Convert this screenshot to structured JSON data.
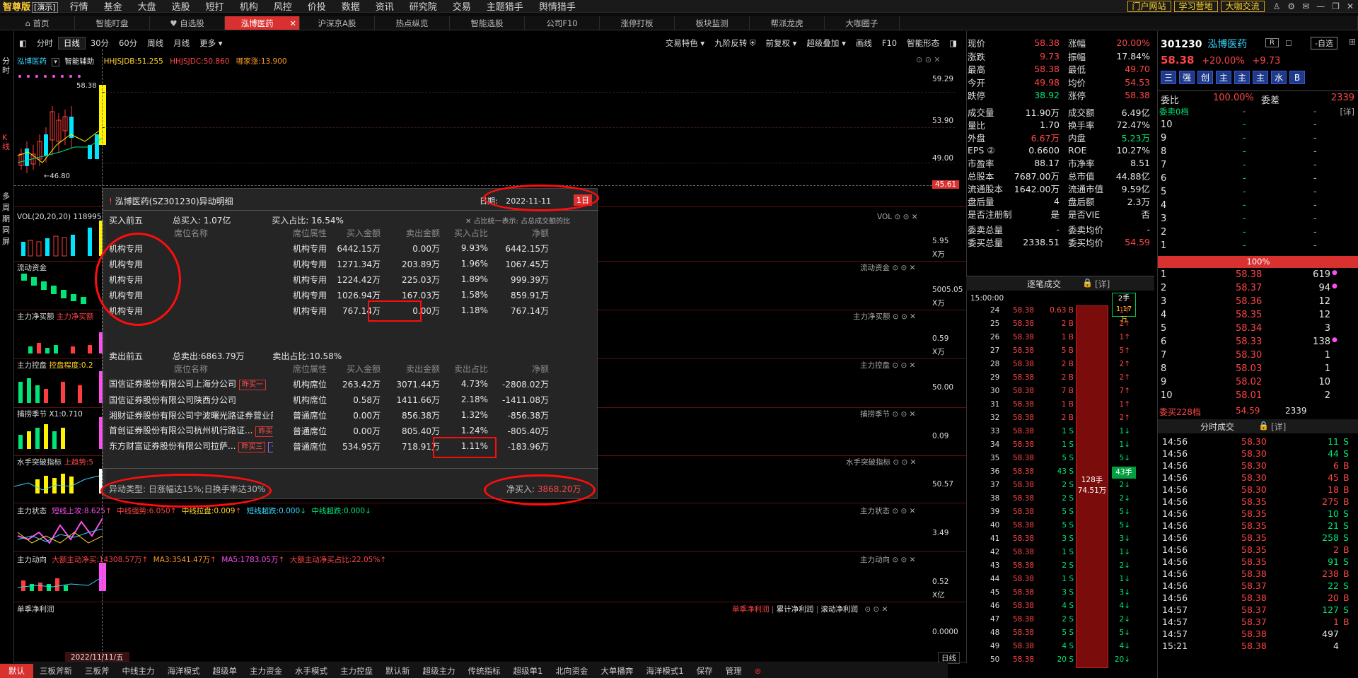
{
  "topbar": {
    "logo": "智尊版",
    "mode": "[演示]",
    "menu": [
      "行情",
      "基金",
      "大盘",
      "选股",
      "短打",
      "机构",
      "风控",
      "价投",
      "数据",
      "资讯",
      "研究院",
      "交易",
      "主题猎手",
      "舆情猎手"
    ],
    "ext": [
      "门户网站",
      "学习营地",
      "大咖交流"
    ],
    "zoom": "95%"
  },
  "tabs": [
    "首页",
    "智能盯盘",
    "自选股",
    "泓博医药",
    "沪深京A股",
    "热点纵览",
    "智能选股",
    "公司F10",
    "涨停打板",
    "板块监测",
    "帮派龙虎",
    "大咖圈子"
  ],
  "chart_toolbar": {
    "periods": [
      "分时",
      "日线",
      "30分",
      "60分",
      "周线",
      "月线",
      "更多"
    ],
    "right": [
      "交易特色",
      "九阶反转",
      "前复权",
      "超级叠加",
      "画线",
      "F10",
      "智能形态"
    ]
  },
  "kline": {
    "name": "泓博医药",
    "assist": "智能辅助",
    "ind1": "HHJSJDB:51.255",
    "ind2": "HHJSJDC:50.860",
    "ind3": "哪家涨:13.900",
    "high": "58.38",
    "low": "46.80",
    "axis": [
      "59.29",
      "53.90",
      "49.00",
      "45.61"
    ]
  },
  "sidebar": [
    "分时",
    "K线",
    "多周期同屏"
  ],
  "panels": [
    {
      "name": "VOL(20,20,20)",
      "vals": "118995",
      "tag": "VOL",
      "axis": [
        "5.95",
        "X万"
      ]
    },
    {
      "name": "流动资金",
      "tag": "流动资金",
      "axis": [
        "5005.05",
        "X万"
      ]
    },
    {
      "name": "主力净买额",
      "vals": "主力净买额",
      "tag": "主力净买额",
      "axis": [
        "0.59",
        "X万"
      ]
    },
    {
      "name": "主力控盘",
      "vals": "控盘程度:0.2",
      "tag": "主力控盘",
      "axis": [
        "50.00"
      ]
    },
    {
      "name": "捕捞季节",
      "vals": "X1:0.710",
      "tag": "捕捞季节",
      "axis": [
        "0.09"
      ]
    },
    {
      "name": "水手突破指标",
      "vals": "上趋势:5",
      "tag": "水手突破指标",
      "axis": [
        "50.57"
      ]
    },
    {
      "name": "主力状态",
      "vals": [
        "短线上攻:8.625",
        "中线强势:6.050",
        "中线拉盘:0.009",
        "短线超跌:0.000",
        "中线超跌:0.000"
      ],
      "tag": "主力状态",
      "axis": [
        "3.49"
      ]
    },
    {
      "name": "主力动向",
      "vals": [
        "大额主动净买:14308.57万",
        "MA3:3541.47万",
        "MA5:1783.05万",
        "大额主动净买占比:22.05%"
      ],
      "tag": "主力动向",
      "axis": [
        "0.52",
        "X亿"
      ]
    },
    {
      "name": "单季净利润",
      "tabs": [
        "单季净利润",
        "累计净利润",
        "滚动净利润"
      ],
      "axis": [
        "0.0000"
      ]
    }
  ],
  "date_label": "2022/11/11/五",
  "dayline": "日线",
  "popup": {
    "title": "泓博医药(SZ301230)异动明细",
    "date_label": "日期:",
    "date": "2022-11-11",
    "day_btn": "1日",
    "buy_label": "买入前五",
    "buy_total": "总买入: 1.07亿",
    "buy_ratio": "买入占比: 16.54%",
    "note": "占比统一表示: 占总成交额的比",
    "headers": [
      "席位名称",
      "席位属性",
      "买入金额",
      "卖出金额",
      "买入占比",
      "净额"
    ],
    "buy_rows": [
      [
        "机构专用",
        "机构专用",
        "6442.15万",
        "0.00万",
        "9.93%",
        "6442.15万"
      ],
      [
        "机构专用",
        "机构专用",
        "1271.34万",
        "203.89万",
        "1.96%",
        "1067.45万"
      ],
      [
        "机构专用",
        "机构专用",
        "1224.42万",
        "225.03万",
        "1.89%",
        "999.39万"
      ],
      [
        "机构专用",
        "机构专用",
        "1026.94万",
        "167.03万",
        "1.58%",
        "859.91万"
      ],
      [
        "机构专用",
        "机构专用",
        "767.14万",
        "0.00万",
        "1.18%",
        "767.14万"
      ]
    ],
    "sell_label": "卖出前五",
    "sell_total": "总卖出:6863.79万",
    "sell_ratio": "卖出占比:10.58%",
    "sell_headers": [
      "席位名称",
      "席位属性",
      "买入金额",
      "卖出金额",
      "卖出占比",
      "净额"
    ],
    "sell_rows": [
      {
        "name": "国信证券股份有限公司上海分公司",
        "tags": [
          "昨买一"
        ],
        "attr": "机构席位",
        "buy": "263.42万",
        "sell": "3071.44万",
        "ratio": "4.73%",
        "net": "-2808.02万"
      },
      {
        "name": "国信证券股份有限公司陕西分公司",
        "tags": [],
        "attr": "机构席位",
        "buy": "0.58万",
        "sell": "1411.66万",
        "ratio": "2.18%",
        "net": "-1411.08万"
      },
      {
        "name": "湘财证券股份有限公司宁波曙光路证券营业部",
        "tags": [],
        "attr": "普通席位",
        "buy": "0.00万",
        "sell": "856.38万",
        "ratio": "1.32%",
        "net": "-856.38万"
      },
      {
        "name": "首创证券股份有限公司杭州机行路证...",
        "tags": [
          "昨买二"
        ],
        "attr": "普通席位",
        "buy": "0.00万",
        "sell": "805.40万",
        "ratio": "1.24%",
        "net": "-805.40万"
      },
      {
        "name": "东方财富证券股份有限公司拉萨...",
        "tags": [
          "昨买三",
          "一线"
        ],
        "attr": "普通席位",
        "buy": "534.95万",
        "sell": "718.91万",
        "ratio": "1.11%",
        "net": "-183.96万"
      }
    ],
    "type_label": "异动类型:",
    "type_text": "日涨幅达15%;日换手率达30%",
    "net_label": "净买入:",
    "net_value": "3868.20万"
  },
  "quote": {
    "rows": [
      [
        "现价",
        "58.38",
        "涨幅",
        "20.00%"
      ],
      [
        "涨跌",
        "9.73",
        "振幅",
        "17.84%"
      ],
      [
        "最高",
        "58.38",
        "最低",
        "49.70"
      ],
      [
        "今开",
        "49.98",
        "均价",
        "54.53"
      ],
      [
        "跌停",
        "38.92",
        "涨停",
        "58.38"
      ],
      [
        "成交量",
        "11.90万",
        "成交额",
        "6.49亿"
      ],
      [
        "量比",
        "1.70",
        "换手率",
        "72.47%"
      ],
      [
        "外盘",
        "6.67万",
        "内盘",
        "5.23万"
      ],
      [
        "EPS ②",
        "0.6600",
        "ROE",
        "10.27%"
      ],
      [
        "市盈率",
        "88.17",
        "市净率",
        "8.51"
      ],
      [
        "总股本",
        "7687.00万",
        "总市值",
        "44.88亿"
      ],
      [
        "流通股本",
        "1642.00万",
        "流通市值",
        "9.59亿"
      ],
      [
        "盘后量",
        "4",
        "盘后额",
        "2.3万"
      ],
      [
        "是否注册制",
        "是",
        "是否VIE",
        "否"
      ],
      [
        "委卖总量",
        "-",
        "委卖均价",
        "-"
      ],
      [
        "委买总量",
        "2338.51",
        "委买均价",
        "54.59"
      ]
    ],
    "tick_title": "逐笔成交",
    "tick_detail": "[详]",
    "time_label": "15:00:00"
  },
  "ticks": [
    [
      "24",
      "58.38",
      "0.63 B",
      "1↑"
    ],
    [
      "25",
      "58.38",
      "2 B",
      "2↑"
    ],
    [
      "26",
      "58.38",
      "1 B",
      "1↑"
    ],
    [
      "27",
      "58.38",
      "5 B",
      "5↑"
    ],
    [
      "28",
      "58.38",
      "2 B",
      "2↑"
    ],
    [
      "29",
      "58.38",
      "2 B",
      "2↑"
    ],
    [
      "30",
      "58.38",
      "7 B",
      "7↑"
    ],
    [
      "31",
      "58.38",
      "1 B",
      "1↑"
    ],
    [
      "32",
      "58.38",
      "2 B",
      "2↑"
    ],
    [
      "33",
      "58.38",
      "1 S",
      "1↓"
    ],
    [
      "34",
      "58.38",
      "1 S",
      "1↓"
    ],
    [
      "35",
      "58.38",
      "5 S",
      "5↓"
    ],
    [
      "36",
      "58.38",
      "43 S",
      ""
    ],
    [
      "37",
      "58.38",
      "2 S",
      "2↓"
    ],
    [
      "38",
      "58.38",
      "2 S",
      "2↓"
    ],
    [
      "39",
      "58.38",
      "5 S",
      "5↓"
    ],
    [
      "40",
      "58.38",
      "5 S",
      "5↓"
    ],
    [
      "41",
      "58.38",
      "3 S",
      "3↓"
    ],
    [
      "42",
      "58.38",
      "1 S",
      "1↓"
    ],
    [
      "43",
      "58.38",
      "2 S",
      "2↓"
    ],
    [
      "44",
      "58.38",
      "1 S",
      "1↓"
    ],
    [
      "45",
      "58.38",
      "3 S",
      "3↓"
    ],
    [
      "46",
      "58.38",
      "4 S",
      "4↓"
    ],
    [
      "47",
      "58.38",
      "2 S",
      "2↓"
    ],
    [
      "48",
      "58.38",
      "5 S",
      "5↓"
    ],
    [
      "49",
      "58.38",
      "4 S",
      "4↓"
    ],
    [
      "50",
      "58.38",
      "20 S",
      "20↓"
    ]
  ],
  "tick_bar": {
    "top_label": "2手",
    "top_sub": "1.17万",
    "mid": "128手",
    "mid2": "74.51万",
    "side": "43手"
  },
  "orderbook": {
    "code": "301230",
    "name": "泓博医药",
    "r": "R",
    "add": "-自选",
    "price": "58.38",
    "pct": "+20.00%",
    "chg": "+9.73",
    "badges": [
      "三",
      "强",
      "创",
      "主",
      "主",
      "主",
      "水",
      "B"
    ],
    "wb_label": "委比",
    "wb": "100.00%",
    "wc_label": "委差",
    "wc": "2339",
    "sell_head": "委卖0档",
    "sell_detail": "[详]",
    "sell_levels": [
      "10",
      "9",
      "8",
      "7",
      "6",
      "5",
      "4",
      "3",
      "2",
      "1"
    ],
    "bar_label": "100%",
    "buy_levels": [
      [
        "1",
        "58.38",
        "619"
      ],
      [
        "2",
        "58.37",
        "94"
      ],
      [
        "3",
        "58.36",
        "12"
      ],
      [
        "4",
        "58.35",
        "12"
      ],
      [
        "5",
        "58.34",
        "3"
      ],
      [
        "6",
        "58.33",
        "138"
      ],
      [
        "7",
        "58.30",
        "1"
      ],
      [
        "8",
        "58.03",
        "1"
      ],
      [
        "9",
        "58.02",
        "10"
      ],
      [
        "10",
        "58.01",
        "2"
      ]
    ],
    "buy_total": "委买228档",
    "buy_total_px": "54.59",
    "buy_total_vol": "2339",
    "trade_title": "分时成交",
    "trade_detail": "[详]",
    "trades": [
      [
        "14:56",
        "58.30",
        "11",
        "S"
      ],
      [
        "14:56",
        "58.30",
        "44",
        "S"
      ],
      [
        "14:56",
        "58.30",
        "6",
        "B"
      ],
      [
        "14:56",
        "58.30",
        "45",
        "B"
      ],
      [
        "14:56",
        "58.30",
        "18",
        "B"
      ],
      [
        "14:56",
        "58.35",
        "275",
        "B"
      ],
      [
        "14:56",
        "58.35",
        "10",
        "S"
      ],
      [
        "14:56",
        "58.35",
        "21",
        "S"
      ],
      [
        "14:56",
        "58.35",
        "258",
        "S"
      ],
      [
        "14:56",
        "58.35",
        "2",
        "B"
      ],
      [
        "14:56",
        "58.35",
        "91",
        "S"
      ],
      [
        "14:56",
        "58.38",
        "238",
        "B"
      ],
      [
        "14:56",
        "58.37",
        "22",
        "S"
      ],
      [
        "14:56",
        "58.38",
        "20",
        "B"
      ],
      [
        "14:57",
        "58.37",
        "127",
        "S"
      ],
      [
        "14:57",
        "58.37",
        "1",
        "B"
      ],
      [
        "14:57",
        "58.38",
        "497",
        ""
      ],
      [
        "15:21",
        "58.38",
        "4",
        ""
      ]
    ]
  },
  "botbar": [
    "默认",
    "三板斧新",
    "三板斧",
    "中线主力",
    "海洋模式",
    "超级单",
    "主力资金",
    "水手模式",
    "主力控盘",
    "默认新",
    "超级主力",
    "传统指标",
    "超级单1",
    "北向资金",
    "大单播奔",
    "海洋模式1",
    "保存",
    "管理"
  ],
  "colors": {
    "up": "#ff4545",
    "down": "#00e676",
    "active_tab": "#d93030",
    "annotation": "#ff0d0d"
  }
}
